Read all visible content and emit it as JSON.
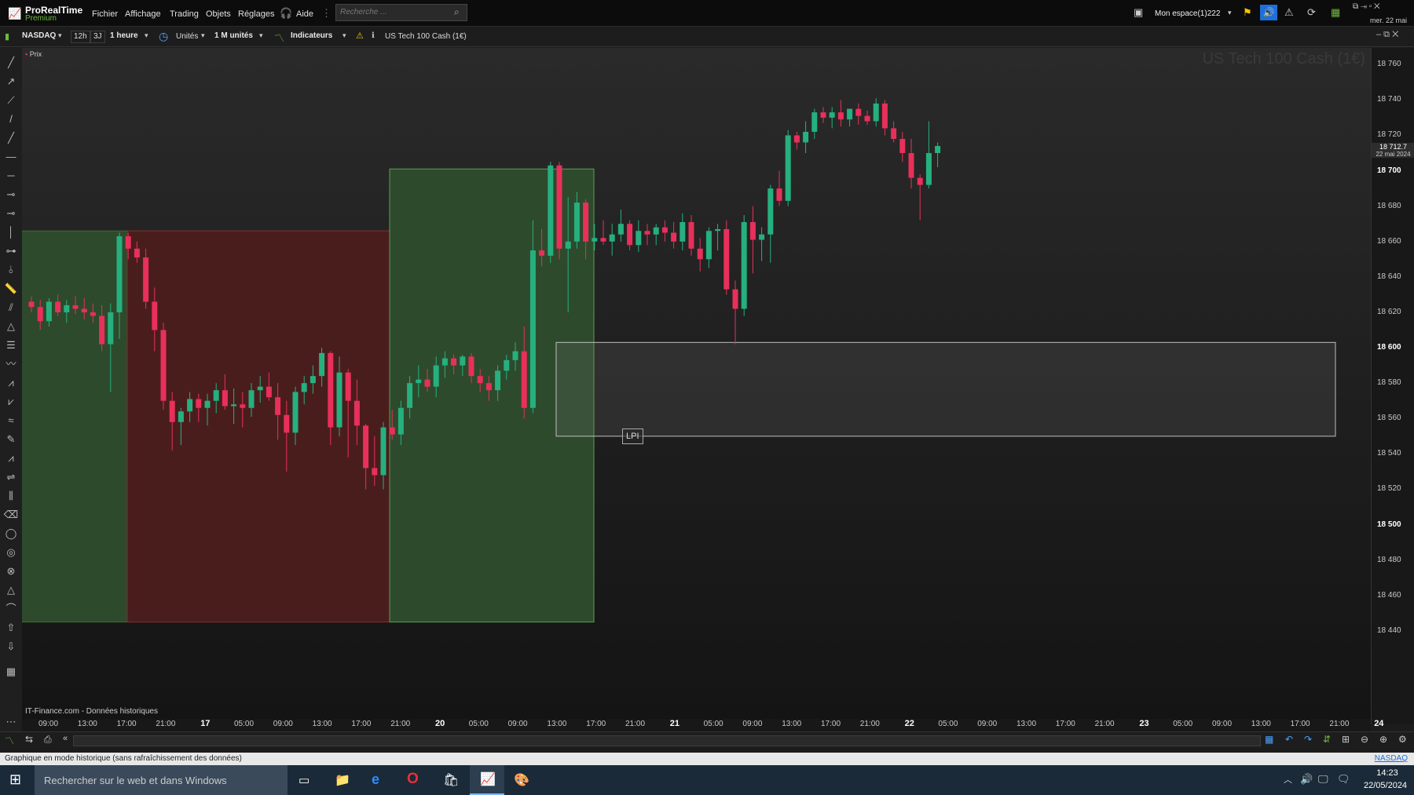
{
  "app": {
    "name": "ProRealTime",
    "edition": "Premium"
  },
  "menu": [
    "Fichier",
    "Affichage",
    "Trading",
    "Objets",
    "Réglages"
  ],
  "help_label": "Aide",
  "search_placeholder": "Recherche ...",
  "workspace": "Mon espace(1)222",
  "header_date": "mer. 22 mai",
  "toolbar": {
    "exchange": "NASDAQ",
    "range_12h": "12h",
    "range_3j": "3J",
    "timeframe": "1 heure",
    "units_label": "Unités",
    "units_count": "1 M unités",
    "indicators": "Indicateurs",
    "instrument": "US Tech 100 Cash (1€)"
  },
  "chart": {
    "price_label": "Prix",
    "watermark": "US Tech 100 Cash (1€)",
    "source": "IT-Finance.com - Données historiques",
    "zone_label": "LPI",
    "last_price": "18 712.7",
    "last_date": "22 mai 2024",
    "y_ticks": [
      {
        "v": 18760,
        "label": "18 760"
      },
      {
        "v": 18740,
        "label": "18 740"
      },
      {
        "v": 18720,
        "label": "18 720"
      },
      {
        "v": 18700,
        "label": "18 700",
        "major": true
      },
      {
        "v": 18680,
        "label": "18 680"
      },
      {
        "v": 18660,
        "label": "18 660"
      },
      {
        "v": 18640,
        "label": "18 640"
      },
      {
        "v": 18620,
        "label": "18 620"
      },
      {
        "v": 18600,
        "label": "18 600",
        "major": true
      },
      {
        "v": 18580,
        "label": "18 580"
      },
      {
        "v": 18560,
        "label": "18 560"
      },
      {
        "v": 18540,
        "label": "18 540"
      },
      {
        "v": 18520,
        "label": "18 520"
      },
      {
        "v": 18500,
        "label": "18 500",
        "major": true
      },
      {
        "v": 18480,
        "label": "18 480"
      },
      {
        "v": 18460,
        "label": "18 460"
      },
      {
        "v": 18440,
        "label": "18 440"
      }
    ],
    "x_ticks": [
      "09:00",
      "13:00",
      "17:00",
      "21:00",
      "17",
      "05:00",
      "09:00",
      "13:00",
      "17:00",
      "21:00",
      "20",
      "05:00",
      "09:00",
      "13:00",
      "17:00",
      "21:00",
      "21",
      "05:00",
      "09:00",
      "13:00",
      "17:00",
      "21:00",
      "22",
      "05:00",
      "09:00",
      "13:00",
      "17:00",
      "21:00",
      "23",
      "05:00",
      "09:00",
      "13:00",
      "17:00",
      "21:00",
      "24"
    ],
    "colors": {
      "up": "#26b07f",
      "down": "#e8305a",
      "green_zone": "#2e4a2c",
      "red_zone": "#4a1d1d"
    },
    "candles": [
      [
        18626,
        18629,
        18620,
        18623
      ],
      [
        18623,
        18627,
        18610,
        18615
      ],
      [
        18615,
        18628,
        18612,
        18626
      ],
      [
        18626,
        18630,
        18618,
        18620
      ],
      [
        18620,
        18627,
        18614,
        18624
      ],
      [
        18624,
        18629,
        18619,
        18622
      ],
      [
        18622,
        18628,
        18616,
        18620
      ],
      [
        18620,
        18625,
        18614,
        18618
      ],
      [
        18618,
        18624,
        18598,
        18602
      ],
      [
        18602,
        18625,
        18575,
        18620
      ],
      [
        18620,
        18665,
        18605,
        18663
      ],
      [
        18663,
        18665,
        18650,
        18656
      ],
      [
        18656,
        18660,
        18648,
        18651
      ],
      [
        18651,
        18656,
        18622,
        18626
      ],
      [
        18626,
        18634,
        18598,
        18610
      ],
      [
        18610,
        18614,
        18565,
        18570
      ],
      [
        18570,
        18575,
        18542,
        18558
      ],
      [
        18558,
        18566,
        18545,
        18564
      ],
      [
        18564,
        18575,
        18558,
        18571
      ],
      [
        18571,
        18574,
        18558,
        18566
      ],
      [
        18566,
        18574,
        18556,
        18570
      ],
      [
        18570,
        18580,
        18563,
        18576
      ],
      [
        18576,
        18585,
        18565,
        18567
      ],
      [
        18567,
        18577,
        18557,
        18568
      ],
      [
        18568,
        18575,
        18555,
        18566
      ],
      [
        18566,
        18580,
        18561,
        18576
      ],
      [
        18576,
        18584,
        18569,
        18578
      ],
      [
        18578,
        18586,
        18570,
        18572
      ],
      [
        18572,
        18580,
        18548,
        18562
      ],
      [
        18562,
        18570,
        18530,
        18552
      ],
      [
        18552,
        18578,
        18545,
        18575
      ],
      [
        18575,
        18584,
        18568,
        18580
      ],
      [
        18580,
        18590,
        18574,
        18584
      ],
      [
        18584,
        18600,
        18578,
        18597
      ],
      [
        18597,
        18598,
        18545,
        18555
      ],
      [
        18555,
        18595,
        18550,
        18586
      ],
      [
        18586,
        18588,
        18538,
        18570
      ],
      [
        18570,
        18582,
        18545,
        18556
      ],
      [
        18556,
        18557,
        18520,
        18532
      ],
      [
        18532,
        18550,
        18522,
        18528
      ],
      [
        18528,
        18558,
        18520,
        18555
      ],
      [
        18555,
        18565,
        18548,
        18551
      ],
      [
        18551,
        18570,
        18545,
        18566
      ],
      [
        18566,
        18584,
        18560,
        18580
      ],
      [
        18580,
        18590,
        18572,
        18582
      ],
      [
        18582,
        18588,
        18575,
        18578
      ],
      [
        18578,
        18595,
        18572,
        18590
      ],
      [
        18590,
        18598,
        18583,
        18594
      ],
      [
        18594,
        18596,
        18585,
        18590
      ],
      [
        18590,
        18596,
        18584,
        18595
      ],
      [
        18595,
        18597,
        18580,
        18584
      ],
      [
        18584,
        18588,
        18575,
        18580
      ],
      [
        18580,
        18584,
        18570,
        18576
      ],
      [
        18576,
        18590,
        18570,
        18587
      ],
      [
        18587,
        18596,
        18582,
        18593
      ],
      [
        18593,
        18603,
        18587,
        18598
      ],
      [
        18598,
        18612,
        18560,
        18566
      ],
      [
        18566,
        18672,
        18563,
        18655
      ],
      [
        18655,
        18667,
        18646,
        18652
      ],
      [
        18652,
        18705,
        18648,
        18703
      ],
      [
        18703,
        18705,
        18650,
        18656
      ],
      [
        18656,
        18685,
        18620,
        18660
      ],
      [
        18660,
        18688,
        18656,
        18682
      ],
      [
        18682,
        18684,
        18650,
        18660
      ],
      [
        18660,
        18670,
        18655,
        18662
      ],
      [
        18662,
        18672,
        18658,
        18660
      ],
      [
        18660,
        18670,
        18652,
        18664
      ],
      [
        18664,
        18678,
        18660,
        18670
      ],
      [
        18670,
        18672,
        18655,
        18658
      ],
      [
        18658,
        18672,
        18654,
        18666
      ],
      [
        18666,
        18670,
        18658,
        18664
      ],
      [
        18664,
        18670,
        18658,
        18668
      ],
      [
        18668,
        18672,
        18660,
        18665
      ],
      [
        18665,
        18671,
        18656,
        18660
      ],
      [
        18660,
        18676,
        18655,
        18671
      ],
      [
        18671,
        18675,
        18652,
        18656
      ],
      [
        18656,
        18662,
        18643,
        18650
      ],
      [
        18650,
        18668,
        18645,
        18666
      ],
      [
        18666,
        18670,
        18655,
        18667
      ],
      [
        18667,
        18672,
        18630,
        18633
      ],
      [
        18633,
        18638,
        18602,
        18622
      ],
      [
        18622,
        18675,
        18618,
        18671
      ],
      [
        18671,
        18680,
        18642,
        18661
      ],
      [
        18661,
        18668,
        18649,
        18664
      ],
      [
        18664,
        18692,
        18648,
        18690
      ],
      [
        18690,
        18700,
        18680,
        18683
      ],
      [
        18683,
        18723,
        18680,
        18720
      ],
      [
        18720,
        18722,
        18712,
        18716
      ],
      [
        18716,
        18728,
        18710,
        18722
      ],
      [
        18722,
        18735,
        18718,
        18733
      ],
      [
        18733,
        18736,
        18727,
        18730
      ],
      [
        18730,
        18736,
        18724,
        18733
      ],
      [
        18733,
        18740,
        18725,
        18729
      ],
      [
        18729,
        18734,
        18725,
        18735
      ],
      [
        18735,
        18738,
        18726,
        18731
      ],
      [
        18731,
        18734,
        18726,
        18728
      ],
      [
        18728,
        18741,
        18725,
        18738
      ],
      [
        18738,
        18740,
        18720,
        18724
      ],
      [
        18724,
        18728,
        18716,
        18718
      ],
      [
        18718,
        18722,
        18705,
        18710
      ],
      [
        18710,
        18718,
        18690,
        18696
      ],
      [
        18696,
        18698,
        18672,
        18692
      ],
      [
        18692,
        18728,
        18690,
        18710
      ],
      [
        18710,
        18716,
        18702,
        18714
      ]
    ]
  },
  "status": "Graphique en mode historique (sans rafraîchissement des données)",
  "status_right": "NASDAQ",
  "taskbar": {
    "search": "Rechercher sur le web et dans Windows",
    "time": "14:23",
    "date": "22/05/2024"
  }
}
